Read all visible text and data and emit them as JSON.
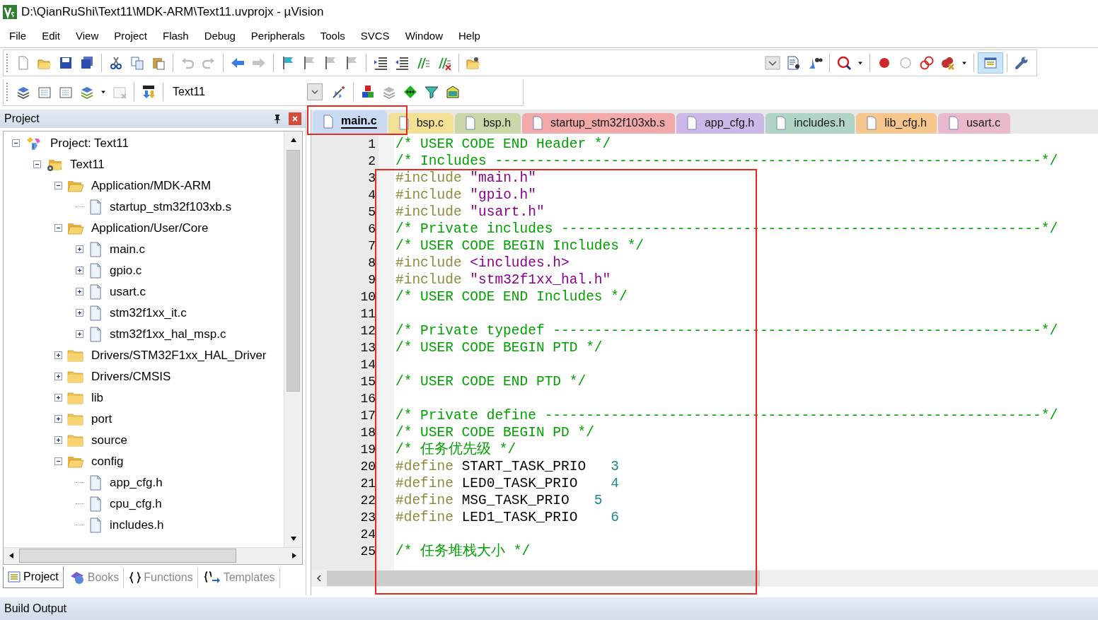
{
  "window": {
    "title": "D:\\QianRuShi\\Text11\\MDK-ARM\\Text11.uvprojx - µVision"
  },
  "menu": [
    "File",
    "Edit",
    "View",
    "Project",
    "Flash",
    "Debug",
    "Peripherals",
    "Tools",
    "SVCS",
    "Window",
    "Help"
  ],
  "build_toolbar": {
    "target": "Text11"
  },
  "project_panel": {
    "title": "Project",
    "tree": [
      {
        "label": "Project: Text11",
        "kind": "project",
        "expanded": true,
        "children": [
          {
            "label": "Text11",
            "kind": "target",
            "expanded": true,
            "children": [
              {
                "label": "Application/MDK-ARM",
                "kind": "folder",
                "expanded": true,
                "children": [
                  {
                    "label": "startup_stm32f103xb.s",
                    "kind": "file"
                  }
                ]
              },
              {
                "label": "Application/User/Core",
                "kind": "folder",
                "expanded": true,
                "children": [
                  {
                    "label": "main.c",
                    "kind": "file",
                    "expanded": false
                  },
                  {
                    "label": "gpio.c",
                    "kind": "file",
                    "expanded": false
                  },
                  {
                    "label": "usart.c",
                    "kind": "file",
                    "expanded": false
                  },
                  {
                    "label": "stm32f1xx_it.c",
                    "kind": "file",
                    "expanded": false
                  },
                  {
                    "label": "stm32f1xx_hal_msp.c",
                    "kind": "file",
                    "expanded": false
                  }
                ]
              },
              {
                "label": "Drivers/STM32F1xx_HAL_Driver",
                "kind": "folder",
                "expanded": false
              },
              {
                "label": "Drivers/CMSIS",
                "kind": "folder",
                "expanded": false
              },
              {
                "label": "lib",
                "kind": "folder",
                "expanded": false
              },
              {
                "label": "port",
                "kind": "folder",
                "expanded": false
              },
              {
                "label": "source",
                "kind": "folder",
                "expanded": false
              },
              {
                "label": "config",
                "kind": "folder",
                "expanded": true,
                "children": [
                  {
                    "label": "app_cfg.h",
                    "kind": "file"
                  },
                  {
                    "label": "cpu_cfg.h",
                    "kind": "file"
                  },
                  {
                    "label": "includes.h",
                    "kind": "file"
                  }
                ]
              }
            ]
          }
        ]
      }
    ],
    "tabs": [
      {
        "label": "Project",
        "kind": "project",
        "selected": true
      },
      {
        "label": "Books",
        "kind": "books",
        "selected": false
      },
      {
        "label": "Functions",
        "kind": "functions",
        "selected": false
      },
      {
        "label": "Templates",
        "kind": "templates",
        "selected": false
      }
    ]
  },
  "editor": {
    "tabs": [
      {
        "label": "main.c",
        "selected": true,
        "color": "#c9daf2"
      },
      {
        "label": "bsp.c",
        "selected": false,
        "color": "#f6e08c"
      },
      {
        "label": "bsp.h",
        "selected": false,
        "color": "#c7d6a2"
      },
      {
        "label": "startup_stm32f103xb.s",
        "selected": false,
        "color": "#f2a3a3"
      },
      {
        "label": "app_cfg.h",
        "selected": false,
        "color": "#cbb4ea"
      },
      {
        "label": "includes.h",
        "selected": false,
        "color": "#aad2c2"
      },
      {
        "label": "lib_cfg.h",
        "selected": false,
        "color": "#f8c383"
      },
      {
        "label": "usart.c",
        "selected": false,
        "color": "#eab4cb"
      }
    ],
    "lines": [
      {
        "number": "1",
        "tokens": [
          {
            "kind": "comment",
            "text": "/* USER CODE END Header */"
          }
        ]
      },
      {
        "number": "2",
        "tokens": [
          {
            "kind": "comment",
            "text": "/* Includes ------------------------------------------------------------------*/"
          }
        ]
      },
      {
        "number": "3",
        "tokens": [
          {
            "kind": "directive",
            "text": "#include"
          },
          {
            "kind": "string",
            "text": "\"main.h\""
          }
        ]
      },
      {
        "number": "4",
        "tokens": [
          {
            "kind": "directive",
            "text": "#include"
          },
          {
            "kind": "string",
            "text": "\"gpio.h\""
          }
        ]
      },
      {
        "number": "5",
        "tokens": [
          {
            "kind": "directive",
            "text": "#include"
          },
          {
            "kind": "string",
            "text": "\"usart.h\""
          }
        ]
      },
      {
        "number": "6",
        "tokens": [
          {
            "kind": "comment",
            "text": "/* Private includes ----------------------------------------------------------*/"
          }
        ]
      },
      {
        "number": "7",
        "tokens": [
          {
            "kind": "comment",
            "text": "/* USER CODE BEGIN Includes */"
          }
        ]
      },
      {
        "number": "8",
        "tokens": [
          {
            "kind": "directive",
            "text": "#include"
          },
          {
            "kind": "string",
            "text": "<includes.h>"
          }
        ]
      },
      {
        "number": "9",
        "tokens": [
          {
            "kind": "directive",
            "text": "#include"
          },
          {
            "kind": "string",
            "text": "\"stm32f1xx_hal.h\""
          }
        ]
      },
      {
        "number": "10",
        "tokens": [
          {
            "kind": "comment",
            "text": "/* USER CODE END Includes */"
          }
        ]
      },
      {
        "number": "11"
      },
      {
        "number": "12",
        "tokens": [
          {
            "kind": "comment",
            "text": "/* Private typedef -----------------------------------------------------------*/"
          }
        ]
      },
      {
        "number": "13",
        "tokens": [
          {
            "kind": "comment",
            "text": "/* USER CODE BEGIN PTD */"
          }
        ]
      },
      {
        "number": "14"
      },
      {
        "number": "15",
        "tokens": [
          {
            "kind": "comment",
            "text": "/* USER CODE END PTD */"
          }
        ]
      },
      {
        "number": "16"
      },
      {
        "number": "17",
        "tokens": [
          {
            "kind": "comment",
            "text": "/* Private define ------------------------------------------------------------*/"
          }
        ]
      },
      {
        "number": "18",
        "tokens": [
          {
            "kind": "comment",
            "text": "/* USER CODE BEGIN PD */"
          }
        ]
      },
      {
        "number": "19",
        "tokens": [
          {
            "kind": "comment",
            "text": "/* 任务优先级 */"
          }
        ]
      },
      {
        "number": "20",
        "tokens": [
          {
            "kind": "directive",
            "text": "#define"
          },
          {
            "kind": "plain",
            "text": "START_TASK_PRIO   "
          },
          {
            "kind": "number",
            "text": "3"
          }
        ]
      },
      {
        "number": "21",
        "tokens": [
          {
            "kind": "directive",
            "text": "#define"
          },
          {
            "kind": "plain",
            "text": "LED0_TASK_PRIO    "
          },
          {
            "kind": "number",
            "text": "4"
          }
        ]
      },
      {
        "number": "22",
        "tokens": [
          {
            "kind": "directive",
            "text": "#define"
          },
          {
            "kind": "plain",
            "text": "MSG_TASK_PRIO   "
          },
          {
            "kind": "number",
            "text": "5"
          }
        ]
      },
      {
        "number": "23",
        "tokens": [
          {
            "kind": "directive",
            "text": "#define"
          },
          {
            "kind": "plain",
            "text": "LED1_TASK_PRIO    "
          },
          {
            "kind": "number",
            "text": "6"
          }
        ]
      },
      {
        "number": "24"
      },
      {
        "number": "25",
        "tokens": [
          {
            "kind": "comment",
            "text": "/* 任务堆栈大小 */"
          }
        ]
      }
    ]
  },
  "build_output": {
    "title": "Build Output"
  }
}
